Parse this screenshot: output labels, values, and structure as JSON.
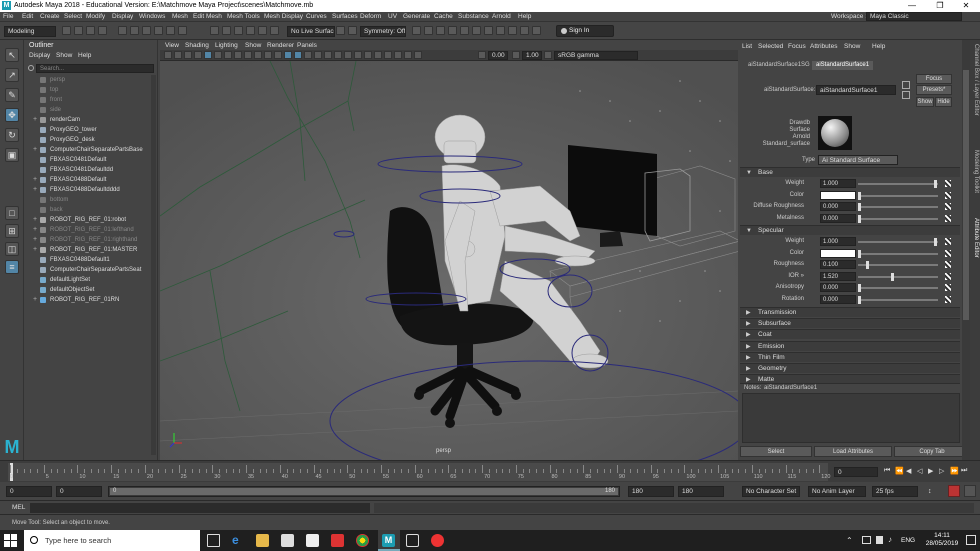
{
  "window": {
    "title": "Autodesk Maya 2018 - Educational Version: E:\\Matchmove Maya Project\\scenes\\Matchmove.mb",
    "minimize": "—",
    "maximize": "❐",
    "close": "✕"
  },
  "menubar": {
    "items": [
      "File",
      "Edit",
      "Create",
      "Select",
      "Modify",
      "Display",
      "Windows",
      "Mesh",
      "Edit Mesh",
      "Mesh Tools",
      "Mesh Display",
      "Curves",
      "Surfaces",
      "Deform",
      "UV",
      "Generate",
      "Cache",
      "Substance",
      "Arnold",
      "Help"
    ],
    "workspace_label": "Workspace :",
    "workspace_value": "Maya Classic"
  },
  "shelf": {
    "mode": "Modeling",
    "live_surface": "No Live Surface",
    "symmetry": "Symmetry: Off",
    "sign_in": "Sign In"
  },
  "outliner": {
    "title": "Outliner",
    "menu": [
      "Display",
      "Show",
      "Help"
    ],
    "search_placeholder": "Search...",
    "items": [
      {
        "label": "persp",
        "dim": true,
        "exp": "",
        "icon": "camera-icon",
        "color": "#777"
      },
      {
        "label": "top",
        "dim": true,
        "exp": "",
        "icon": "camera-icon",
        "color": "#777"
      },
      {
        "label": "front",
        "dim": true,
        "exp": "",
        "icon": "camera-icon",
        "color": "#777"
      },
      {
        "label": "side",
        "dim": true,
        "exp": "",
        "icon": "camera-icon",
        "color": "#777"
      },
      {
        "label": "renderCam",
        "dim": false,
        "exp": "+",
        "icon": "camera-icon",
        "color": "#999"
      },
      {
        "label": "ProxyGEO_tower",
        "dim": false,
        "exp": "",
        "icon": "mesh-icon",
        "color": "#9ab"
      },
      {
        "label": "ProxyGEO_desk",
        "dim": false,
        "exp": "",
        "icon": "mesh-icon",
        "color": "#9ab"
      },
      {
        "label": "ComputerChairSeparatePartsBase",
        "dim": false,
        "exp": "+",
        "icon": "mesh-icon",
        "color": "#9ab"
      },
      {
        "label": "FBXASC0481Default",
        "dim": false,
        "exp": "",
        "icon": "mesh-icon",
        "color": "#9ab"
      },
      {
        "label": "FBXASC0481Defaultdd",
        "dim": false,
        "exp": "",
        "icon": "mesh-icon",
        "color": "#9ab"
      },
      {
        "label": "FBXASC0488Default",
        "dim": false,
        "exp": "+",
        "icon": "mesh-icon",
        "color": "#9ab"
      },
      {
        "label": "FBXASC0488Defaultdddd",
        "dim": false,
        "exp": "+",
        "icon": "mesh-icon",
        "color": "#9ab"
      },
      {
        "label": "bottom",
        "dim": true,
        "exp": "",
        "icon": "camera-icon",
        "color": "#777"
      },
      {
        "label": "back",
        "dim": true,
        "exp": "",
        "icon": "camera-icon",
        "color": "#777"
      },
      {
        "label": "ROBOT_RIG_REF_01:robot",
        "dim": false,
        "exp": "+",
        "icon": "group-icon",
        "color": "#aaa"
      },
      {
        "label": "ROBOT_RIG_REF_01:lefthand",
        "dim": true,
        "exp": "+",
        "icon": "group-icon",
        "color": "#888"
      },
      {
        "label": "ROBOT_RIG_REF_01:righthand",
        "dim": true,
        "exp": "+",
        "icon": "group-icon",
        "color": "#888"
      },
      {
        "label": "ROBOT_RIG_REF_01:MASTER",
        "dim": false,
        "exp": "+",
        "icon": "group-icon",
        "color": "#aaa"
      },
      {
        "label": "FBXASC0488Default1",
        "dim": false,
        "exp": "",
        "icon": "mesh-icon",
        "color": "#9ab"
      },
      {
        "label": "ComputerChairSeparatePartsSeat",
        "dim": false,
        "exp": "",
        "icon": "mesh-icon",
        "color": "#9ab"
      },
      {
        "label": "defaultLightSet",
        "dim": false,
        "exp": "",
        "icon": "set-icon",
        "color": "#7ac"
      },
      {
        "label": "defaultObjectSet",
        "dim": false,
        "exp": "",
        "icon": "set-icon",
        "color": "#7ac"
      },
      {
        "label": "ROBOT_RIG_REF_01RN",
        "dim": false,
        "exp": "+",
        "icon": "reference-icon",
        "color": "#6ad"
      }
    ]
  },
  "viewport": {
    "menu": [
      "View",
      "Shading",
      "Lighting",
      "Show",
      "Renderer",
      "Panels"
    ],
    "exposure": "0.00",
    "gamma": "1.00",
    "colorspace": "sRGB gamma",
    "camera_label": "persp"
  },
  "attr": {
    "menu": [
      "List",
      "Selected",
      "Focus",
      "Attributes",
      "Show",
      "Help"
    ],
    "tabs": [
      "aiStandardSurface1SG",
      "aiStandardSurface1"
    ],
    "node_label": "aiStandardSurface:",
    "node_value": "aiStandardSurface1",
    "focus": "Focus",
    "presets": "Presets*",
    "show": "Show",
    "hide": "Hide",
    "swatch_lines": [
      "Drawdb",
      "Surface",
      "Arnold",
      "Standard_surface"
    ],
    "type_label": "Type",
    "type_value": "Ai Standard Surface",
    "base_section": "Base",
    "base_rows": [
      {
        "label": "Weight",
        "value": "1.000",
        "kind": "slider",
        "level": 1.0
      },
      {
        "label": "Color",
        "value": "",
        "kind": "color",
        "level": 0
      },
      {
        "label": "Diffuse Roughness",
        "value": "0.000",
        "kind": "slider",
        "level": 0.0
      },
      {
        "label": "Metalness",
        "value": "0.000",
        "kind": "slider",
        "level": 0.0
      }
    ],
    "specular_section": "Specular",
    "specular_rows": [
      {
        "label": "Weight",
        "value": "1.000",
        "kind": "slider",
        "level": 1.0
      },
      {
        "label": "Color",
        "value": "",
        "kind": "color",
        "level": 0
      },
      {
        "label": "Roughness",
        "value": "0.100",
        "kind": "slider",
        "level": 0.1
      },
      {
        "label": "IOR »",
        "value": "1.520",
        "kind": "slider",
        "level": 0.43
      },
      {
        "label": "Anisotropy",
        "value": "0.000",
        "kind": "slider",
        "level": 0.0
      },
      {
        "label": "Rotation",
        "value": "0.000",
        "kind": "slider",
        "level": 0.0
      }
    ],
    "collapsed_sections": [
      "Transmission",
      "Subsurface",
      "Coat",
      "Emission",
      "Thin Film",
      "Geometry",
      "Matte"
    ],
    "notes_label": "Notes:",
    "notes_value": "aiStandardSurface1",
    "select_btn": "Select",
    "load_btn": "Load Attributes",
    "copy_btn": "Copy Tab"
  },
  "side_tabs": [
    "Channel Box / Layer Editor",
    "Modeling Toolkit",
    "Attribute Editor"
  ],
  "timeline": {
    "ticks": [
      "5",
      "10",
      "15",
      "20",
      "25",
      "30",
      "35",
      "40",
      "45",
      "50",
      "55",
      "60",
      "65",
      "70",
      "75",
      "80",
      "85",
      "90",
      "95",
      "100",
      "105",
      "110",
      "115",
      "120"
    ],
    "tick0": "0",
    "current": "0"
  },
  "range": {
    "start": "0",
    "start2": "0",
    "slider_start": "0",
    "slider_end": "180",
    "end": "180",
    "end2": "180",
    "character_set": "No Character Set",
    "anim_layer": "No Anim Layer",
    "fps": "25 fps"
  },
  "command": {
    "label": "MEL"
  },
  "help": {
    "text": "Move Tool: Select an object to move."
  },
  "taskbar": {
    "search_placeholder": "Type here to search",
    "time": "14:11",
    "date": "28/05/2019",
    "lang": "ENG"
  }
}
